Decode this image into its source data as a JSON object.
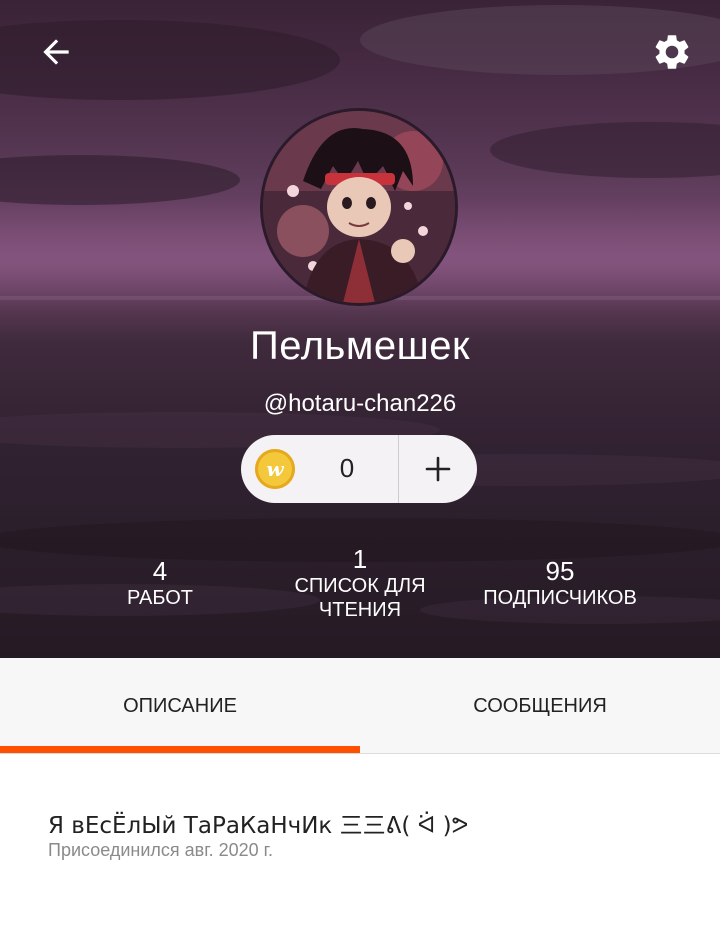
{
  "header": {
    "back_icon": "arrow-left-icon",
    "settings_icon": "gear-icon"
  },
  "profile": {
    "display_name": "Пельмешек",
    "username": "@hotaru-chan226",
    "coins": {
      "icon": "wattpad-coin-icon",
      "letter": "w",
      "count": "0",
      "add_icon": "plus-icon"
    },
    "stats": [
      {
        "value": "4",
        "label_line1": "РАБОТ",
        "label_line2": ""
      },
      {
        "value": "1",
        "label_line1": "СПИСОК ДЛЯ",
        "label_line2": "ЧТЕНИЯ"
      },
      {
        "value": "95",
        "label_line1": "ПОДПИСЧИКОВ",
        "label_line2": ""
      }
    ]
  },
  "tabs": [
    {
      "label": "ОПИСАНИЕ",
      "active": true
    },
    {
      "label": "СООБЩЕНИЯ",
      "active": false
    }
  ],
  "about": {
    "bio": "Я вЕсЁлЫй ТаРаКаНчИк 三三ᕕ( ᐛ )ᕗ",
    "joined": "Присоединился авг. 2020 г."
  },
  "colors": {
    "accent": "#ff5000",
    "coin": "#f3c83a"
  }
}
